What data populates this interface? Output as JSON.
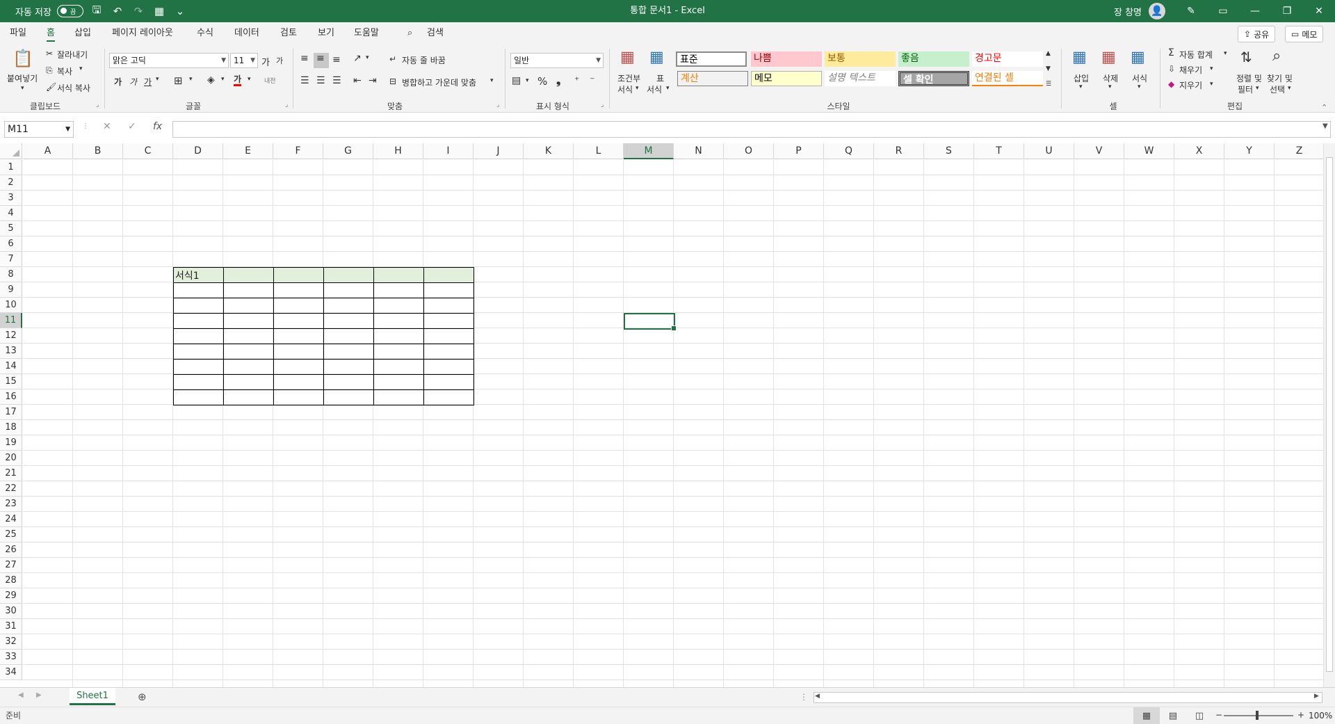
{
  "titlebar": {
    "autosave_label": "자동 저장",
    "autosave_state": "끔",
    "doc_title": "통합 문서1  -  Excel",
    "user_name": "장 창명",
    "more_glyph": "⌄"
  },
  "tabs": [
    {
      "label": "파일"
    },
    {
      "label": "홈"
    },
    {
      "label": "삽입"
    },
    {
      "label": "페이지 레이아웃"
    },
    {
      "label": "수식"
    },
    {
      "label": "데이터"
    },
    {
      "label": "검토"
    },
    {
      "label": "보기"
    },
    {
      "label": "도움말"
    },
    {
      "label": "검색"
    }
  ],
  "share_label": "공유",
  "memo_label": "메모",
  "ribbon": {
    "clipboard": {
      "paste": "붙여넣기",
      "cut": "잘라내기",
      "copy": "복사",
      "format_painter": "서식 복사",
      "group": "클립보드"
    },
    "font": {
      "name": "맑은 고딕",
      "size": "11",
      "grow": "가",
      "shrink": "가",
      "bold": "가",
      "italic": "가",
      "underline": "가",
      "font_color": "가",
      "phonetic": "내천",
      "group": "글꼴"
    },
    "alignment": {
      "wrap": "자동 줄 바꿈",
      "merge": "병합하고 가운데 맞춤",
      "group": "맞춤"
    },
    "number": {
      "format": "일반",
      "percent": "%",
      "comma": "❟",
      "group": "표시 형식"
    },
    "styles": {
      "conditional": [
        "조건부",
        "서식"
      ],
      "table": [
        "표",
        "서식"
      ],
      "cells": [
        {
          "label": "표준",
          "color": "#000000",
          "bg": "#ffffff"
        },
        {
          "label": "나쁨",
          "color": "#9c0006",
          "bg": "#ffc7ce"
        },
        {
          "label": "보통",
          "color": "#9c5700",
          "bg": "#ffeb9c"
        },
        {
          "label": "좋음",
          "color": "#006100",
          "bg": "#c6efce"
        },
        {
          "label": "경고문",
          "color": "#ff0000",
          "bg": "#ffffff"
        },
        {
          "label": "계산",
          "color": "#fa7d00",
          "bg": "#f2f2f2"
        },
        {
          "label": "메모",
          "color": "#000000",
          "bg": "#ffffcc"
        },
        {
          "label": "설명 텍스트",
          "color": "#7f7f7f",
          "bg": "#ffffff"
        },
        {
          "label": "셀 확인",
          "color": "#ffffff",
          "bg": "#a5a5a5"
        },
        {
          "label": "연결된 셀",
          "color": "#fa7d00",
          "bg": "#ffffff"
        }
      ],
      "group": "스타일"
    },
    "cells": {
      "insert": "삽입",
      "delete": "삭제",
      "format": "서식",
      "group": "셀"
    },
    "editing": {
      "autosum": "자동 합계",
      "fill": "채우기",
      "clear": "지우기",
      "sort": [
        "정렬 및",
        "필터"
      ],
      "find": [
        "찾기 및",
        "선택"
      ],
      "group": "편집"
    }
  },
  "formula_bar": {
    "name_box": "M11",
    "fx": "fx",
    "value": ""
  },
  "grid": {
    "columns": [
      "A",
      "B",
      "C",
      "D",
      "E",
      "F",
      "G",
      "H",
      "I",
      "J",
      "K",
      "L",
      "M",
      "N",
      "O",
      "P",
      "Q",
      "R",
      "S",
      "T",
      "U",
      "V",
      "W",
      "X",
      "Y",
      "Z"
    ],
    "active_col": "M",
    "active_row": 11,
    "row_count": 34,
    "table_header_text": "서식1",
    "table_header_color": "#e2efda"
  },
  "sheets": [
    {
      "label": "Sheet1"
    }
  ],
  "status": {
    "ready": "준비",
    "zoom": "100%"
  }
}
